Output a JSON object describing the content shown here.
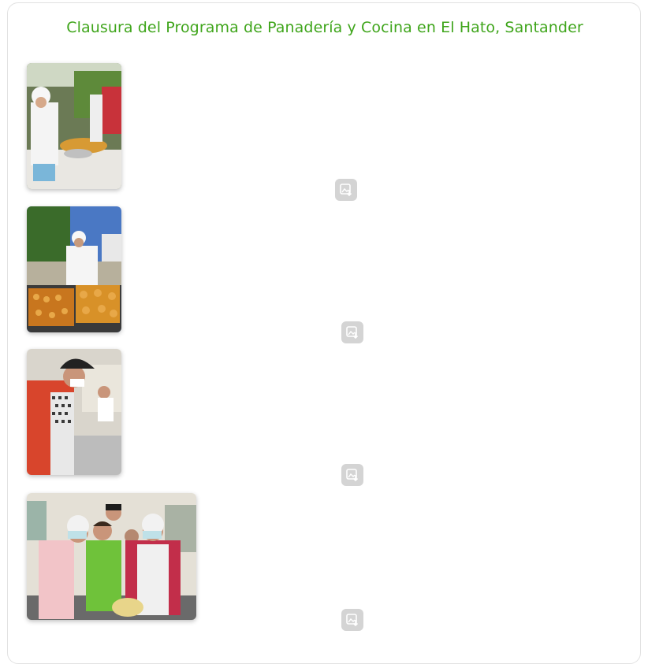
{
  "page": {
    "title": "Clausura del Programa de Panadería y Cocina en El Hato, Santander"
  },
  "gallery": {
    "items": [
      {
        "subject": "baker-serving-pastries",
        "download_icon": "image-download-icon"
      },
      {
        "subject": "baker-with-bread-trays",
        "download_icon": "image-download-icon"
      },
      {
        "subject": "cook-in-red-shirt-kitchen",
        "download_icon": "image-download-icon"
      },
      {
        "subject": "group-in-kitchen",
        "download_icon": "image-download-icon"
      }
    ]
  },
  "colors": {
    "title": "#3fa51b",
    "icon_bg": "#d4d4d4",
    "border": "#e2e2e2"
  }
}
